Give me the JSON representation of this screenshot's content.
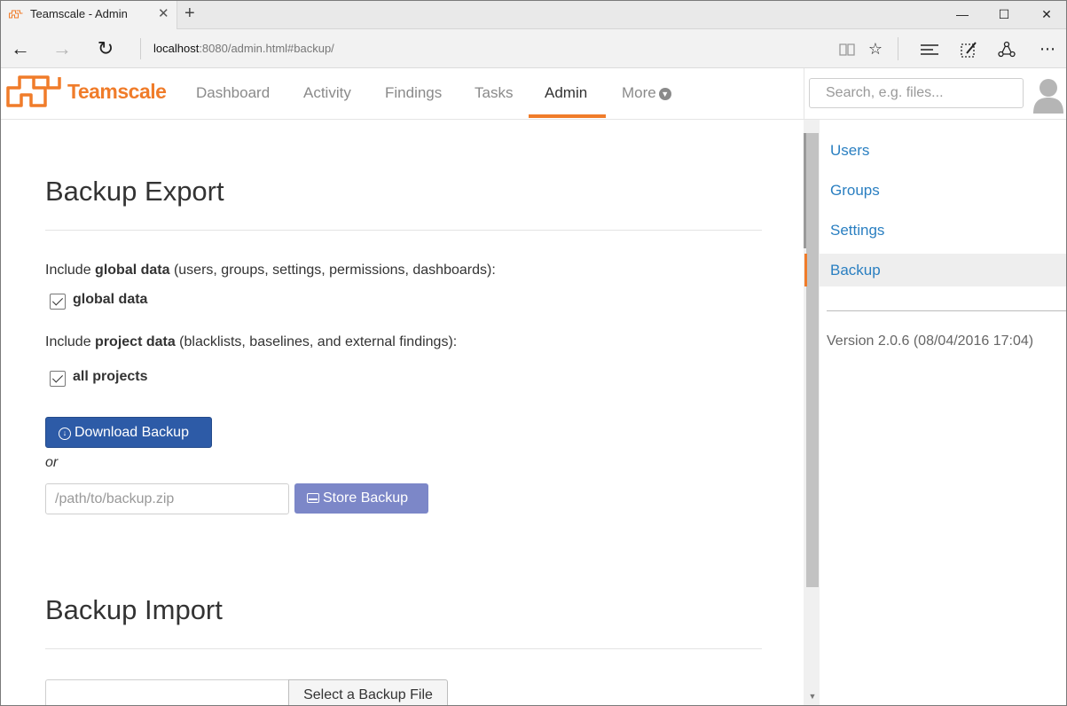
{
  "browser": {
    "tab_title": "Teamscale - Admin",
    "tab_close": "✕",
    "new_tab": "+",
    "window_controls": {
      "minimize": "—",
      "maximize": "☐",
      "close": "✕"
    },
    "url_host": "localhost",
    "url_rest": ":8080/admin.html#backup/",
    "icons": [
      "back-icon",
      "forward-icon",
      "refresh-icon",
      "reading-view-icon",
      "favorite-star-icon",
      "hub-icon",
      "web-note-icon",
      "share-icon"
    ]
  },
  "app": {
    "brand": "Teamscale",
    "brand_color": "#f07c2a",
    "nav": [
      {
        "label": "Dashboard"
      },
      {
        "label": "Activity"
      },
      {
        "label": "Findings"
      },
      {
        "label": "Tasks"
      },
      {
        "label": "Admin",
        "active": true
      },
      {
        "label": "More"
      }
    ],
    "search_placeholder": "Search, e.g. files..."
  },
  "export": {
    "title": "Backup Export",
    "global_prefix": "Include ",
    "global_bold": "global data",
    "global_suffix": " (users, groups, settings, permissions, dashboards):",
    "global_checkbox_label": "global data",
    "global_checked": true,
    "project_prefix": "Include ",
    "project_bold": "project data",
    "project_suffix": " (blacklists, baselines, and external findings):",
    "project_checkbox_label": "all projects",
    "project_checked": true,
    "download_label": "Download Backup",
    "or_text": "or",
    "path_placeholder": "/path/to/backup.zip",
    "store_label": "Store Backup",
    "primary_color": "#2d5ba7",
    "store_color": "#7c87c8"
  },
  "import": {
    "title": "Backup Import",
    "select_label": "Select a Backup File"
  },
  "sidebar": {
    "items": [
      {
        "label": "Users"
      },
      {
        "label": "Groups"
      },
      {
        "label": "Settings"
      },
      {
        "label": "Backup",
        "active": true
      }
    ],
    "version": "Version 2.0.6 (08/04/2016 17:04)",
    "link_color": "#2a7fc1"
  }
}
